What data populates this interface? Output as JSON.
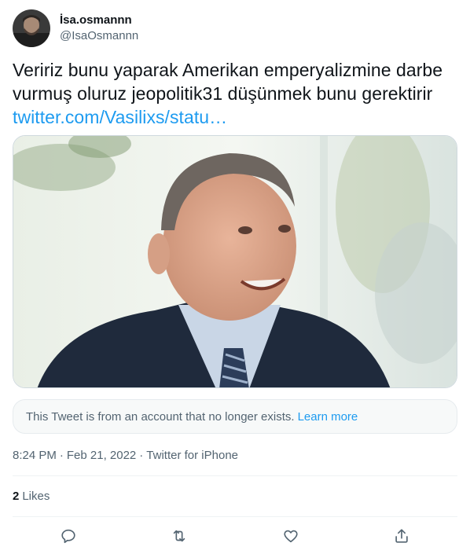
{
  "user": {
    "display_name": "İsa.osmannn",
    "handle": "@IsaOsmannn",
    "avatar_icon": "profile-avatar"
  },
  "tweet": {
    "text_line1": "Veririz bunu yaparak Amerikan emperyalizmine darbe",
    "text_line2": "vurmuş oluruz jeopolitik31 düşünmek bunu gerektirir",
    "link": "twitter.com/Vasilixs/statu…"
  },
  "notice": {
    "text": "This Tweet is from an account that no longer exists.",
    "learn_more": "Learn more"
  },
  "meta": {
    "time": "8:24 PM",
    "separator": "·",
    "date": "Feb 21, 2022",
    "source": "Twitter for iPhone"
  },
  "engagement": {
    "likes_count": "2",
    "likes_label": "Likes"
  },
  "actions": {
    "reply_icon": "reply-icon",
    "retweet_icon": "retweet-icon",
    "like_icon": "heart-icon",
    "share_icon": "share-icon"
  },
  "colors": {
    "text": "#0f1419",
    "secondary": "#536471",
    "link": "#1d9bf0",
    "border": "#cfd9de"
  }
}
